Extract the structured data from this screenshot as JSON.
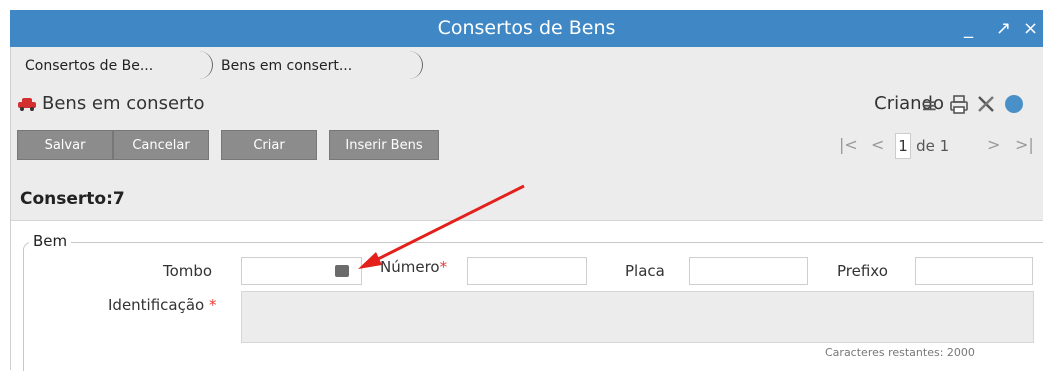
{
  "window": {
    "title": "Consertos de Bens",
    "minimize": "_",
    "restore": "↗",
    "close": "×"
  },
  "tabs": [
    {
      "label": "Consertos de Be..."
    },
    {
      "label": "Bens em consert..."
    }
  ],
  "form": {
    "title": "Bens em conserto",
    "status": "Criando",
    "buttons": {
      "save": "Salvar",
      "cancel": "Cancelar",
      "create": "Criar",
      "insert": "Inserir Bens"
    },
    "pager": {
      "first": "|<",
      "prev": "<",
      "page": "1",
      "of": "de 1",
      "next": ">",
      "last": ">|"
    },
    "record_title": "Conserto:7",
    "section": {
      "legend": "Bem",
      "fields": {
        "tombo": "Tombo",
        "numero": "Número",
        "placa": "Placa",
        "prefixo": "Prefixo",
        "identificacao": "Identificação"
      },
      "chars_remaining": "Caracteres restantes: 2000"
    }
  },
  "colors": {
    "titlebar": "#3f88c5",
    "toolbar": "#ececec",
    "button": "#8c8c8c",
    "required": "#e53935",
    "annotation_arrow": "#e3201b"
  }
}
